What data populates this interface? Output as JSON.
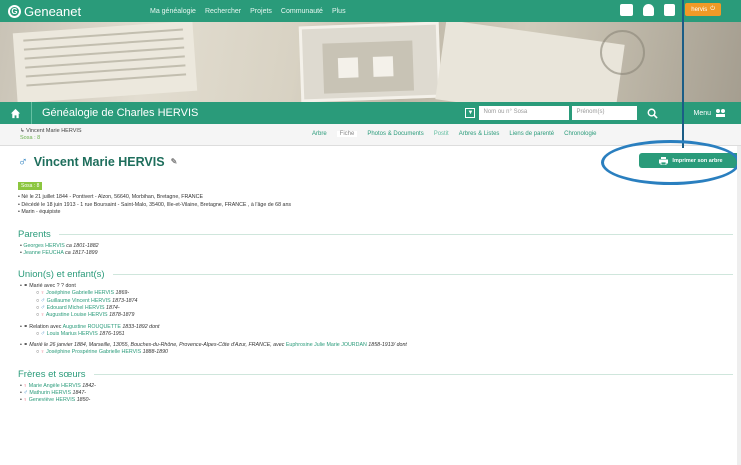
{
  "topbar": {
    "logo_text": "Geneanet",
    "nav": [
      "Ma généalogie",
      "Rechercher",
      "Projets",
      "Communauté",
      "Plus"
    ],
    "user_button": "hervis"
  },
  "site": {
    "title": "Généalogie de Charles HERVIS",
    "sosa_placeholder": "Nom ou n° Sosa",
    "firstname_placeholder": "Prénom(s)",
    "menu_label": "Menu"
  },
  "breadcrumb": {
    "name": "Vincent Marie HERVIS",
    "sosa": "Sosa : 8"
  },
  "tabs": [
    "Arbre",
    "Fiche",
    "Photos & Documents",
    "Postit",
    "Arbres & Listes",
    "Liens de parenté",
    "Chronologie"
  ],
  "person": {
    "name": "Vincent Marie HERVIS",
    "sosa_badge": "Sosa : 8",
    "facts": [
      "Né le 21 juillet 1844 - Pontivert - Alzon, 56640, Morbihan, Bretagne, FRANCE",
      "Décédé le 18 juin 1913 - 1 rue Boursaint - Saint-Malo, 35400, Ille-et-Vilaine, Bretagne, FRANCE , à l'âge de 68 ans",
      "Marin - équipiste"
    ]
  },
  "print_button": "Imprimer son arbre",
  "sections": {
    "parents": {
      "title": "Parents",
      "items": [
        {
          "name": "Georges HERVIS",
          "dates": "ca 1801-1882"
        },
        {
          "name": "Jeanne FEUCHA",
          "dates": "ca 1817-1899"
        }
      ]
    },
    "unions": {
      "title": "Union(s) et enfant(s)",
      "union1": "Marié avec ? ? dont",
      "children1": [
        {
          "name": "Joséphine Gabrielle HERVIS",
          "dates": "1869-"
        },
        {
          "name": "Guillaume Vincent HERVIS",
          "dates": "1873-1874"
        },
        {
          "name": "Edouard Michel HERVIS",
          "dates": "1874-"
        },
        {
          "name": "Augustine Louise HERVIS",
          "dates": "1878-1879"
        }
      ],
      "union2_prefix": "Relation avec",
      "union2_name": "Augustine ROUQUETTE",
      "union2_suffix": "1833-1892 dont",
      "children2": [
        {
          "name": "Louis Marius HERVIS",
          "dates": "1876-1951"
        }
      ],
      "union3_prefix": "Marié le 26 janvier 1884, Marseille, 13055, Bouches-du-Rhône, Provence-Alpes-Côte d'Azur, FRANCE, avec",
      "union3_name": "Euphrosine Julie Marie JOURDAN",
      "union3_suffix": "1858-1913/ dont",
      "children3": [
        {
          "name": "Joséphine Prospérine Gabrielle HERVIS",
          "dates": "1888-1890"
        }
      ]
    },
    "siblings": {
      "title": "Frères et sœurs",
      "items": [
        {
          "name": "Marie Angèle HERVIS",
          "dates": "1842-",
          "sex": "f"
        },
        {
          "name": "Mathurin HERVIS",
          "dates": "1847-",
          "sex": "m"
        },
        {
          "name": "Geneviève HERVIS",
          "dates": "1850-",
          "sex": "f"
        }
      ]
    }
  }
}
